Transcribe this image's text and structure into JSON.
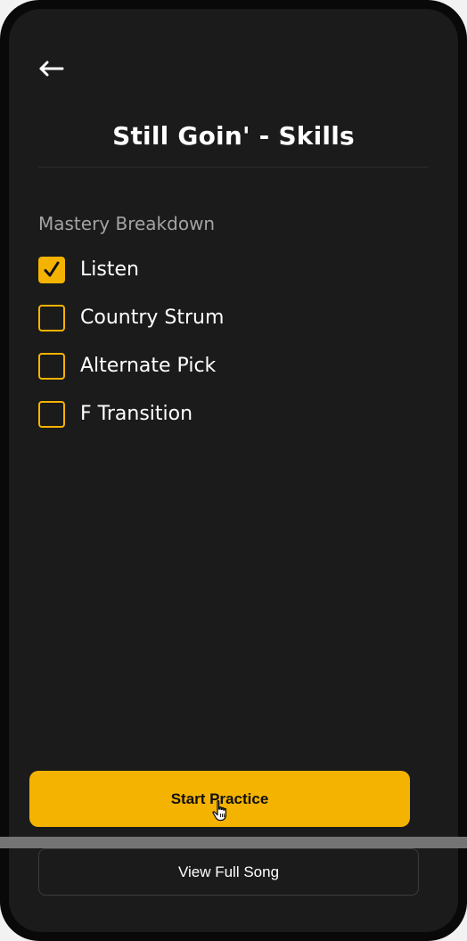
{
  "header": {
    "back_icon": "arrow-left-icon",
    "title": "Still Goin' - Skills"
  },
  "mastery": {
    "section_label": "Mastery Breakdown",
    "skills": [
      {
        "label": "Listen",
        "checked": true
      },
      {
        "label": "Country Strum",
        "checked": false
      },
      {
        "label": "Alternate Pick",
        "checked": false
      },
      {
        "label": "F Transition",
        "checked": false
      }
    ]
  },
  "actions": {
    "start_practice_label": "Start Practice",
    "view_full_song_label": "View Full Song"
  },
  "colors": {
    "accent": "#f5b301",
    "background": "#1b1b1b",
    "text": "#ffffff",
    "muted_text": "#a3a3a3"
  }
}
